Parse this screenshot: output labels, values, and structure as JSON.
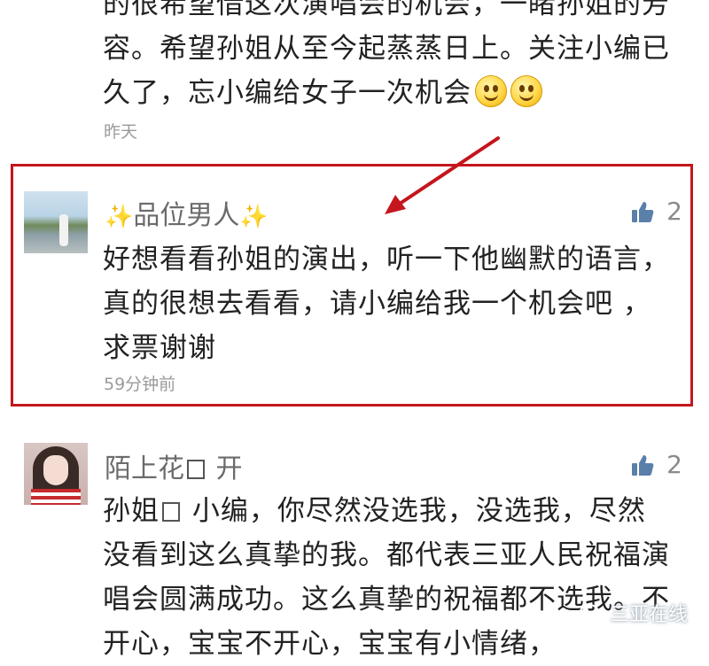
{
  "comments": [
    {
      "text": "的很希望借这次演唱会的机会，一睹孙姐的芳容。希望孙姐从至今起蒸蒸日上。关注小编已久了，忘小编给女子一次机会",
      "emoji_count": 2,
      "time": "昨天"
    },
    {
      "name_sparkle_left": "✨",
      "name": "品位男人",
      "name_sparkle_right": "✨",
      "likes": "2",
      "text": "好想看看孙姐的演出，听一下他幽默的语言，真的很想去看看，请小编给我一个机会吧 ，求票谢谢",
      "time": "59分钟前",
      "highlighted": true
    },
    {
      "name_a": "陌上花",
      "name_b": "开",
      "likes": "2",
      "text_a": "孙姐",
      "text_b": "小编，你尽然没选我，没选我，尽然没看到这么真挚的我。都代表三亚人民祝福演唱会圆满成功。这么真挚的祝福都不选我。不开心，宝宝不开心，宝宝有小情绪，"
    }
  ],
  "watermark": "三亚在线",
  "colors": {
    "highlight_border": "#c4161c",
    "arrow": "#c4161c",
    "like_icon": "#5a7fa8",
    "sparkle": "#f2b200"
  },
  "icons": {
    "like": "thumbs-up-icon",
    "emoji": "smiley-emoji-icon",
    "watermark": "wechat-logo-icon"
  }
}
